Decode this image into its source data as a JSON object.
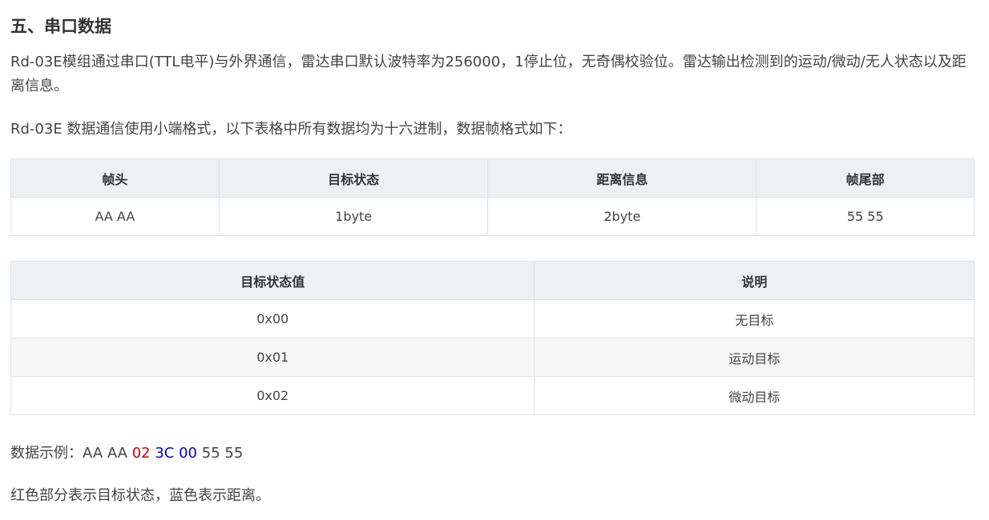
{
  "section": {
    "title": "五、串口数据"
  },
  "intro": {
    "p1": "Rd-03E模组通过串口(TTL电平)与外界通信，雷达串口默认波特率为256000，1停止位，无奇偶校验位。雷达输出检测到的运动/微动/无人状态以及距离信息。",
    "p2": "Rd-03E 数据通信使用小端格式，以下表格中所有数据均为十六进制，数据帧格式如下："
  },
  "frame_table": {
    "headers": [
      "帧头",
      "目标状态",
      "距离信息",
      "帧尾部"
    ],
    "row": [
      "AA AA",
      "1byte",
      "2byte",
      "55 55"
    ]
  },
  "state_table": {
    "headers": [
      "目标状态值",
      "说明"
    ],
    "rows": [
      [
        "0x00",
        "无目标"
      ],
      [
        "0x01",
        "运动目标"
      ],
      [
        "0x02",
        "微动目标"
      ]
    ]
  },
  "example": {
    "prefix": "数据示例：AA AA ",
    "state": "02",
    "space1": " ",
    "dist_low": "3C",
    "space2": " ",
    "dist_high": "00",
    "suffix": " 55 55",
    "colors": {
      "state": "#cc0000",
      "distance": "#0000cc"
    }
  },
  "note": "红色部分表示目标状态，蓝色表示距离。"
}
